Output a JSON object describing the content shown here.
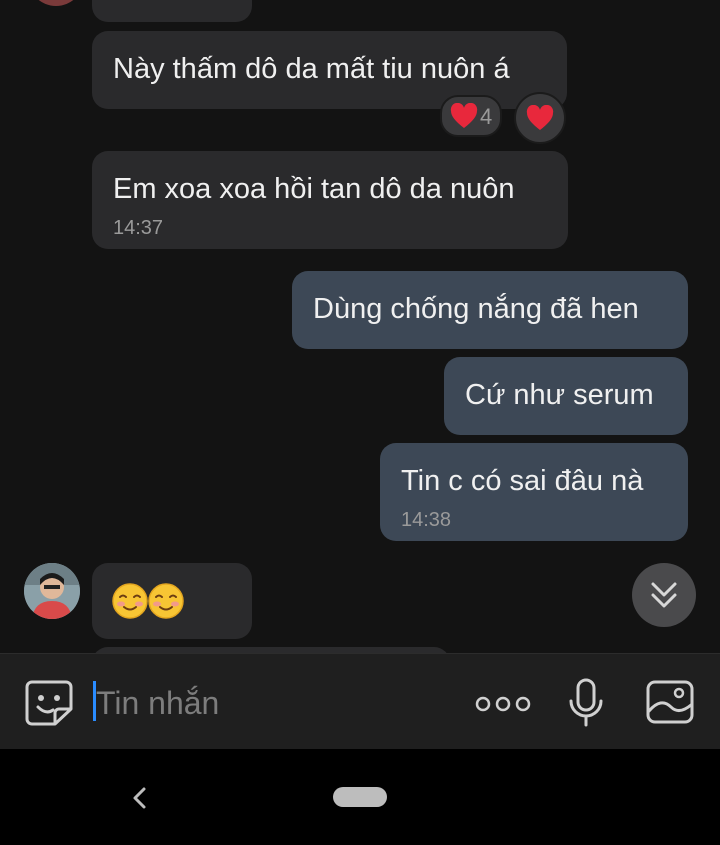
{
  "messages": [
    {
      "text": "Này thấm dô da mất tiu nuôn á",
      "time": "",
      "reactions": {
        "main": "❤️",
        "count": "4",
        "mine": "❤️"
      }
    },
    {
      "text": "Em xoa xoa hồi tan dô da nuôn",
      "time": "14:37"
    },
    {
      "text": "Dùng chống nắng đã hen",
      "time": ""
    },
    {
      "text": "Cứ như serum",
      "time": ""
    },
    {
      "text": "Tin c có sai đâu nà",
      "time": "14:38"
    },
    {
      "text": "",
      "emoji": [
        "blush-emoji",
        "blush-emoji"
      ]
    }
  ],
  "input": {
    "placeholder": "Tin nhắn"
  },
  "icons": {
    "sticker": "sticker-icon",
    "more": "more-options-icon",
    "mic": "microphone-icon",
    "gallery": "gallery-icon",
    "scroll": "scroll-down-icon",
    "back": "back-icon",
    "home": "home-pill-icon"
  },
  "colors": {
    "received_bubble": "#2a2a2c",
    "sent_bubble": "#3d4856",
    "caret": "#2a8cff",
    "heart": "#e8283c"
  }
}
